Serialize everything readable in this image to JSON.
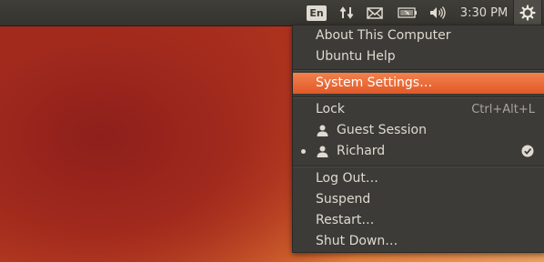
{
  "panel": {
    "keyboard_layout": "En",
    "clock": "3:30 PM",
    "icons": [
      "network-icon",
      "mail-icon",
      "battery-icon",
      "volume-icon",
      "gear-icon"
    ]
  },
  "menu": {
    "about": "About This Computer",
    "help": "Ubuntu Help",
    "settings": "System Settings…",
    "lock": "Lock",
    "lock_shortcut": "Ctrl+Alt+L",
    "guest": "Guest Session",
    "user": "Richard",
    "logout": "Log Out…",
    "suspend": "Suspend",
    "restart": "Restart…",
    "shutdown": "Shut Down…"
  },
  "colors": {
    "highlight": "#f07746",
    "arrow": "#e8141b"
  }
}
